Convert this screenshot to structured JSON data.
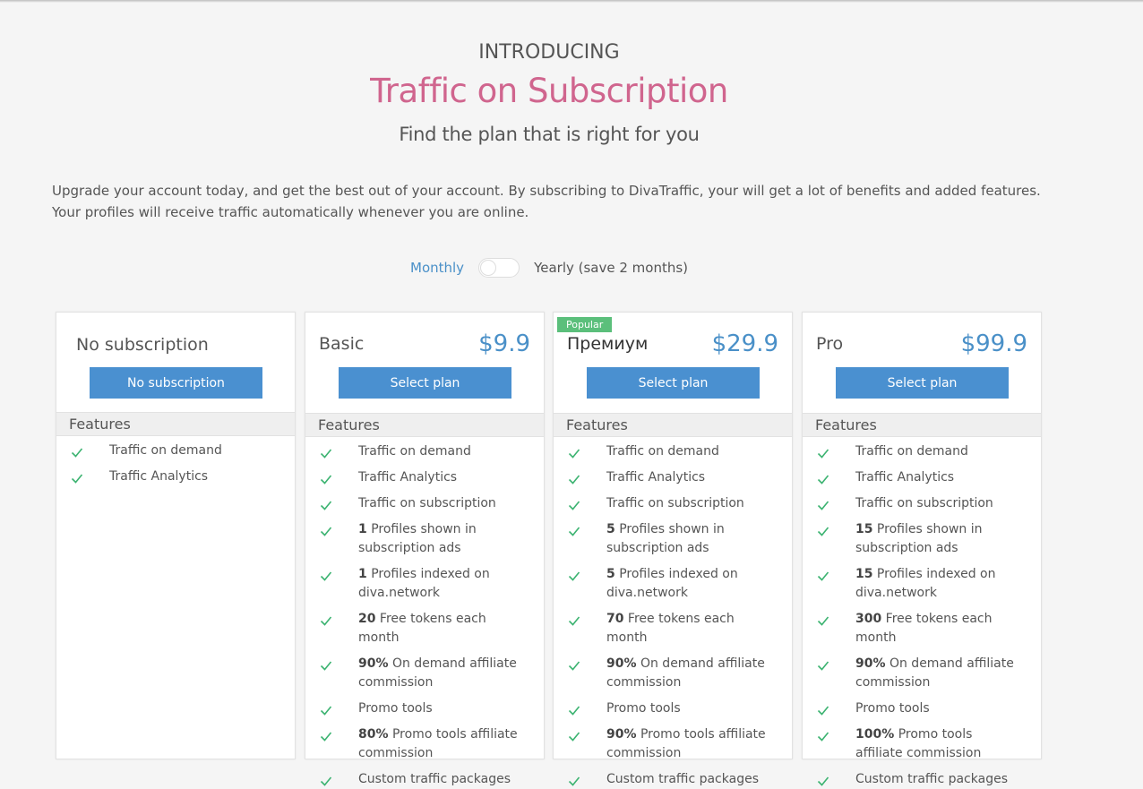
{
  "header": {
    "intro": "INTRODUCING",
    "title": "Traffic on Subscription",
    "subtitle": "Find the plan that is right for you",
    "description_line1": "Upgrade your account today, and get the best out of your account. By subscribing to DivaTraffic, your will get a lot of benefits and added features.",
    "description_line2": "Your profiles will receive traffic automatically whenever you are online."
  },
  "billing": {
    "monthly_label": "Monthly",
    "yearly_label": "Yearly (save 2 months)",
    "selected": "Monthly"
  },
  "features_heading": "Features",
  "plans": [
    {
      "name": "No subscription",
      "price": "",
      "button": "No subscription",
      "features": [
        {
          "bold": "",
          "text": "Traffic on demand"
        },
        {
          "bold": "",
          "text": "Traffic Analytics"
        }
      ]
    },
    {
      "name": "Basic",
      "price": "$9.9",
      "button": "Select plan",
      "features": [
        {
          "bold": "",
          "text": "Traffic on demand"
        },
        {
          "bold": "",
          "text": "Traffic Analytics"
        },
        {
          "bold": "",
          "text": "Traffic on subscription"
        },
        {
          "bold": "1",
          "text": " Profiles shown in subscription ads"
        },
        {
          "bold": "1",
          "text": " Profiles indexed on diva.network"
        },
        {
          "bold": "20",
          "text": " Free tokens each month"
        },
        {
          "bold": "90%",
          "text": " On demand affiliate commission"
        },
        {
          "bold": "",
          "text": "Promo tools"
        },
        {
          "bold": "80%",
          "text": " Promo tools affiliate commission"
        },
        {
          "bold": "",
          "text": "Custom traffic packages"
        }
      ]
    },
    {
      "name": "Премиум",
      "badge": "Popular",
      "price": "$29.9",
      "button": "Select plan",
      "features": [
        {
          "bold": "",
          "text": "Traffic on demand"
        },
        {
          "bold": "",
          "text": "Traffic Analytics"
        },
        {
          "bold": "",
          "text": "Traffic on subscription"
        },
        {
          "bold": "5",
          "text": " Profiles shown in subscription ads"
        },
        {
          "bold": "5",
          "text": " Profiles indexed on diva.network"
        },
        {
          "bold": "70",
          "text": " Free tokens each month"
        },
        {
          "bold": "90%",
          "text": " On demand affiliate commission"
        },
        {
          "bold": "",
          "text": "Promo tools"
        },
        {
          "bold": "90%",
          "text": " Promo tools affiliate commission"
        },
        {
          "bold": "",
          "text": "Custom traffic packages"
        }
      ]
    },
    {
      "name": "Pro",
      "price": "$99.9",
      "button": "Select plan",
      "features": [
        {
          "bold": "",
          "text": "Traffic on demand"
        },
        {
          "bold": "",
          "text": "Traffic Analytics"
        },
        {
          "bold": "",
          "text": "Traffic on subscription"
        },
        {
          "bold": "15",
          "text": " Profiles shown in subscription ads"
        },
        {
          "bold": "15",
          "text": " Profiles indexed on diva.network"
        },
        {
          "bold": "300",
          "text": " Free tokens each month"
        },
        {
          "bold": "90%",
          "text": " On demand affiliate commission"
        },
        {
          "bold": "",
          "text": "Promo tools"
        },
        {
          "bold": "100%",
          "text": " Promo tools affiliate commission"
        },
        {
          "bold": "",
          "text": "Custom traffic packages"
        }
      ]
    }
  ],
  "colors": {
    "accent": "#4a90d0",
    "title": "#d0658e",
    "check": "#3cb371",
    "badge": "#5bbf7b"
  }
}
